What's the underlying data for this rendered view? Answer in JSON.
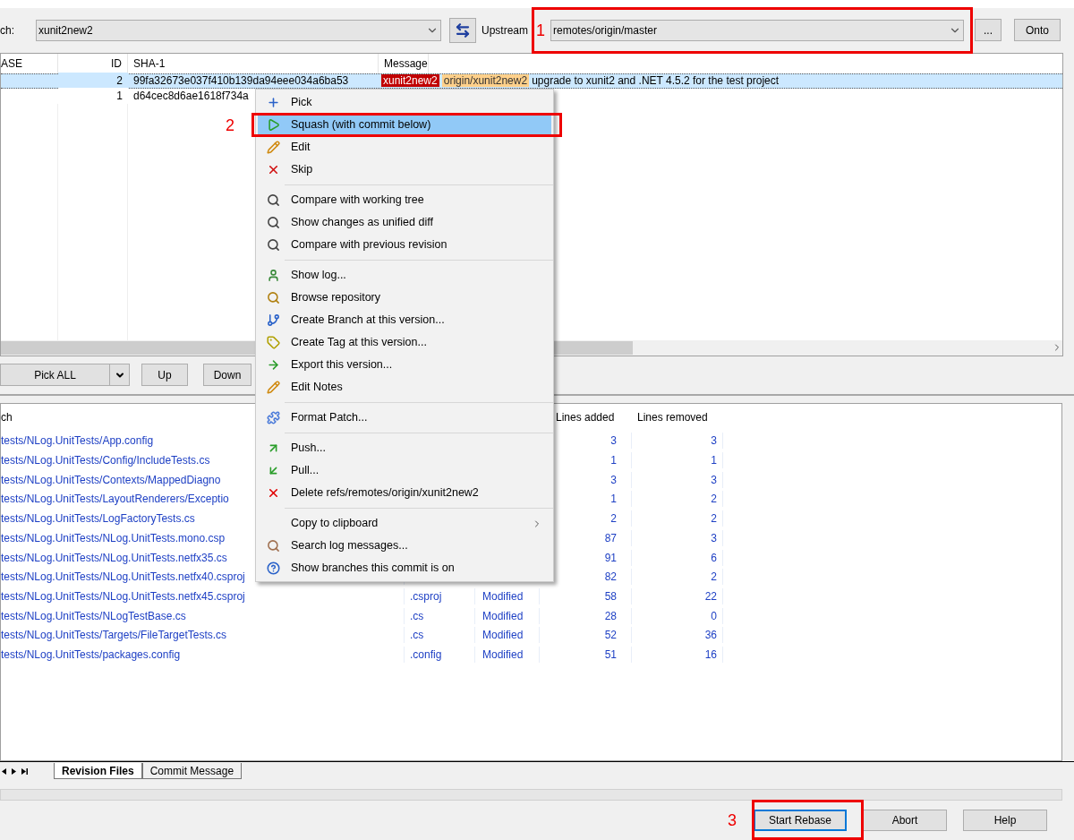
{
  "toolbar": {
    "branch_label": "ch:",
    "branch": "xunit2new2",
    "upstream_label": "Upstream",
    "upstream": "remotes/origin/master",
    "browse_button": "...",
    "onto_button": "Onto"
  },
  "commits": {
    "columns": [
      "ASE",
      "ID",
      "SHA-1",
      "Message"
    ],
    "rows": [
      {
        "selected": true,
        "id": "2",
        "sha": "99fa32673e037f410b139da94eee034a6ba53",
        "tags": [
          {
            "label": "xunit2new2",
            "kind": "local"
          },
          {
            "label": "origin/xunit2new2",
            "kind": "remote"
          }
        ],
        "message": "upgrade to xunit2 and .NET 4.5.2 for the test project"
      },
      {
        "selected": false,
        "id": "1",
        "sha": "d64cec8d6ae1618f734a"
      }
    ]
  },
  "actions": {
    "pick_all": "Pick ALL",
    "up": "Up",
    "down": "Down"
  },
  "files": {
    "path_header": "ch",
    "added_header": "Lines added",
    "removed_header": "Lines removed",
    "rows": [
      {
        "path": "tests/NLog.UnitTests/App.config",
        "added": "3",
        "removed": "3"
      },
      {
        "path": "tests/NLog.UnitTests/Config/IncludeTests.cs",
        "added": "1",
        "removed": "1"
      },
      {
        "path": "tests/NLog.UnitTests/Contexts/MappedDiagno",
        "added": "3",
        "removed": "3"
      },
      {
        "path": "tests/NLog.UnitTests/LayoutRenderers/Exceptio",
        "added": "1",
        "removed": "2"
      },
      {
        "path": "tests/NLog.UnitTests/LogFactoryTests.cs",
        "added": "2",
        "removed": "2"
      },
      {
        "path": "tests/NLog.UnitTests/NLog.UnitTests.mono.csp",
        "added": "87",
        "removed": "3"
      },
      {
        "path": "tests/NLog.UnitTests/NLog.UnitTests.netfx35.cs",
        "added": "91",
        "removed": "6"
      },
      {
        "path": "tests/NLog.UnitTests/NLog.UnitTests.netfx40.csproj",
        "added": "82",
        "removed": "2"
      },
      {
        "path": "tests/NLog.UnitTests/NLog.UnitTests.netfx45.csproj",
        "ext": ".csproj",
        "status": "Modified",
        "added": "58",
        "removed": "22"
      },
      {
        "path": "tests/NLog.UnitTests/NLogTestBase.cs",
        "ext": ".cs",
        "status": "Modified",
        "added": "28",
        "removed": "0"
      },
      {
        "path": "tests/NLog.UnitTests/Targets/FileTargetTests.cs",
        "ext": ".cs",
        "status": "Modified",
        "added": "52",
        "removed": "36"
      },
      {
        "path": "tests/NLog.UnitTests/packages.config",
        "ext": ".config",
        "status": "Modified",
        "added": "51",
        "removed": "16"
      }
    ]
  },
  "tabs": [
    {
      "label": "Revision Files",
      "selected": true
    },
    {
      "label": "Commit Message",
      "selected": false
    }
  ],
  "buttons": [
    {
      "label": "Start Rebase",
      "default": true
    },
    {
      "label": "Abort",
      "default": false
    },
    {
      "label": "Help",
      "default": false
    }
  ],
  "context_menu": {
    "groups": [
      [
        {
          "label": "Pick",
          "selected": false
        },
        {
          "label": "Squash (with commit below)",
          "selected": true
        },
        {
          "label": "Edit",
          "selected": false
        },
        {
          "label": "Skip",
          "selected": false
        }
      ],
      [
        {
          "label": "Compare with working tree",
          "selected": false
        },
        {
          "label": "Show changes as unified diff",
          "selected": false
        },
        {
          "label": "Compare with previous revision",
          "selected": false
        }
      ],
      [
        {
          "label": "Show log...",
          "selected": false
        },
        {
          "label": "Browse repository",
          "selected": false
        },
        {
          "label": "Create Branch at this version...",
          "selected": false
        },
        {
          "label": "Create Tag at this version...",
          "selected": false
        },
        {
          "label": "Export this version...",
          "selected": false
        },
        {
          "label": "Edit Notes",
          "selected": false
        }
      ],
      [
        {
          "label": "Format Patch...",
          "selected": false
        }
      ],
      [
        {
          "label": "Push...",
          "selected": false
        },
        {
          "label": "Pull...",
          "selected": false
        },
        {
          "label": "Delete refs/remotes/origin/xunit2new2",
          "selected": false
        }
      ],
      [
        {
          "label": "Copy to clipboard",
          "selected": false,
          "submenu": true
        },
        {
          "label": "Search log messages...",
          "selected": false
        },
        {
          "label": "Show branches this commit is on",
          "selected": false
        }
      ]
    ]
  },
  "annotations": [
    {
      "number": "1"
    },
    {
      "number": "2"
    },
    {
      "number": "3"
    }
  ]
}
